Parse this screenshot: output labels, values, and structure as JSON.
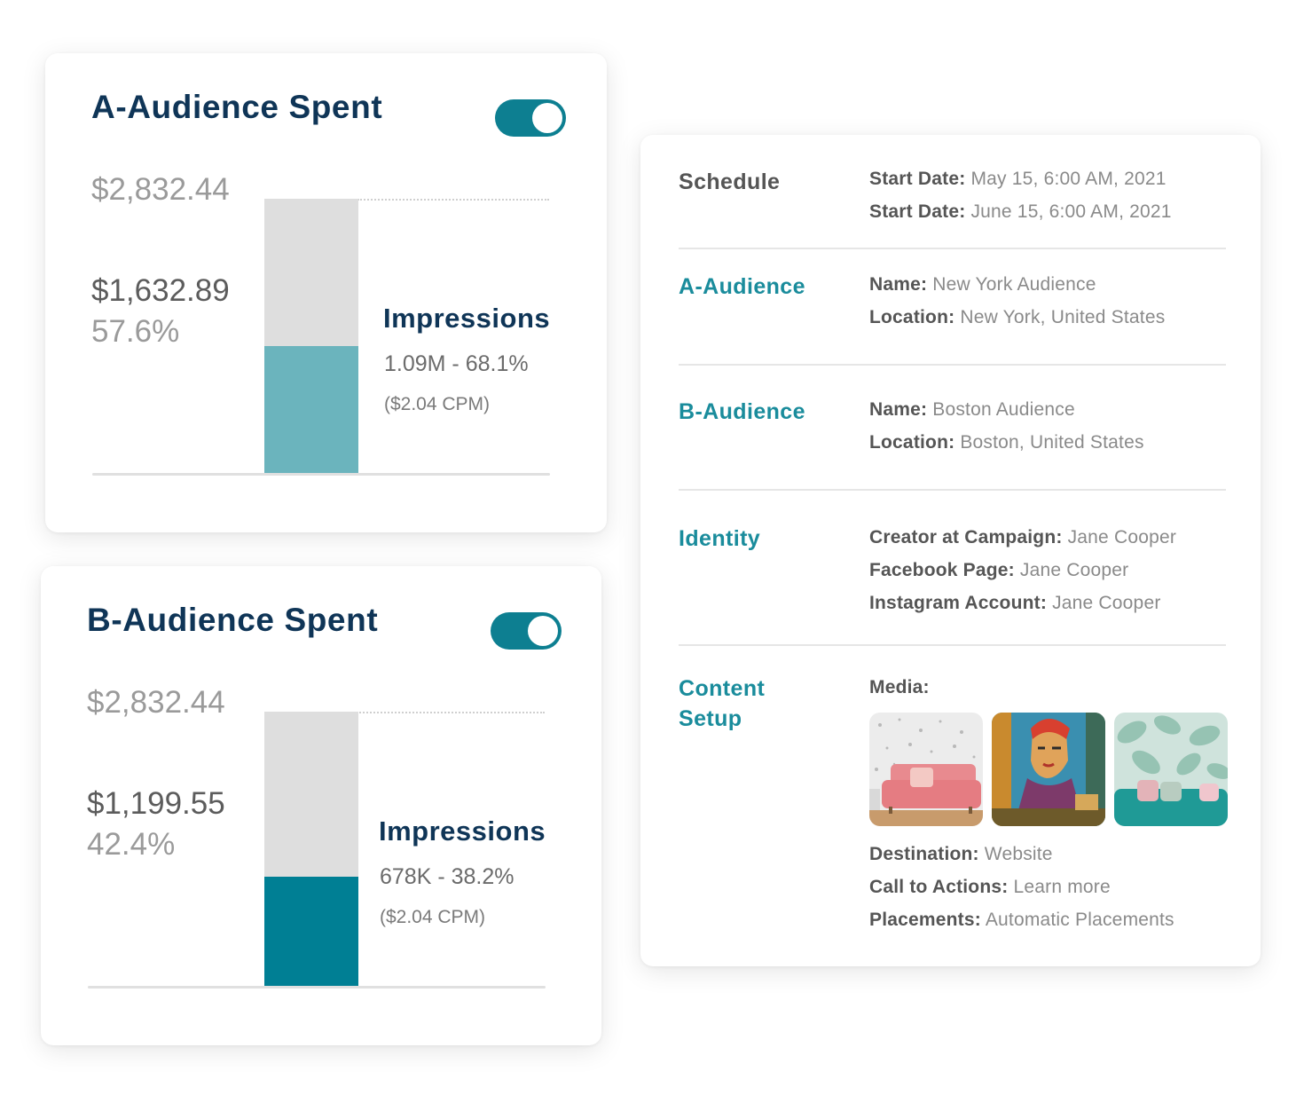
{
  "cards": [
    {
      "title": "A-Audience Spent",
      "toggle_on": true,
      "total": "$2,832.44",
      "spent": "$1,632.89",
      "percent": "57.6%",
      "fill_fraction": 0.466,
      "fill_color": "#6bb4bd",
      "impressions_label": "Impressions",
      "impressions_value": "1.09M - 68.1%",
      "impressions_cpm": "($2.04 CPM)"
    },
    {
      "title": "B-Audience Spent",
      "toggle_on": true,
      "total": "$2,832.44",
      "spent": "$1,199.55",
      "percent": "42.4%",
      "fill_fraction": 0.4,
      "fill_color": "#007f94",
      "impressions_label": "Impressions",
      "impressions_value": "678K - 38.2%",
      "impressions_cpm": "($2.04 CPM)"
    }
  ],
  "details": {
    "schedule": {
      "title": "Schedule",
      "fields": [
        {
          "key": "Start Date:",
          "value": "May 15, 6:00 AM, 2021"
        },
        {
          "key": "Start Date:",
          "value": " June 15, 6:00 AM, 2021"
        }
      ]
    },
    "a_audience": {
      "title": "A-Audience",
      "fields": [
        {
          "key": "Name:",
          "value": "New York Audience"
        },
        {
          "key": "Location:",
          "value": "New York, United States"
        }
      ]
    },
    "b_audience": {
      "title": "B-Audience",
      "fields": [
        {
          "key": "Name:",
          "value": "Boston Audience"
        },
        {
          "key": "Location:",
          "value": "Boston, United States"
        }
      ]
    },
    "identity": {
      "title": "Identity",
      "fields": [
        {
          "key": "Creator at Campaign:",
          "value": "Jane Cooper"
        },
        {
          "key": "Facebook Page:",
          "value": "Jane Cooper"
        },
        {
          "key": "Instagram Account:",
          "value": "Jane Cooper"
        }
      ]
    },
    "content_setup": {
      "title": "Content Setup",
      "media_label": "Media:",
      "fields": [
        {
          "key": "Destination:",
          "value": "Website"
        },
        {
          "key": "Call to Actions:",
          "value": "Learn more"
        },
        {
          "key": "Placements:",
          "value": "Automatic Placements"
        }
      ]
    }
  },
  "colors": {
    "accent": "#0d7f91",
    "title_navy": "#0f3557",
    "section_teal": "#1a8c9c"
  }
}
